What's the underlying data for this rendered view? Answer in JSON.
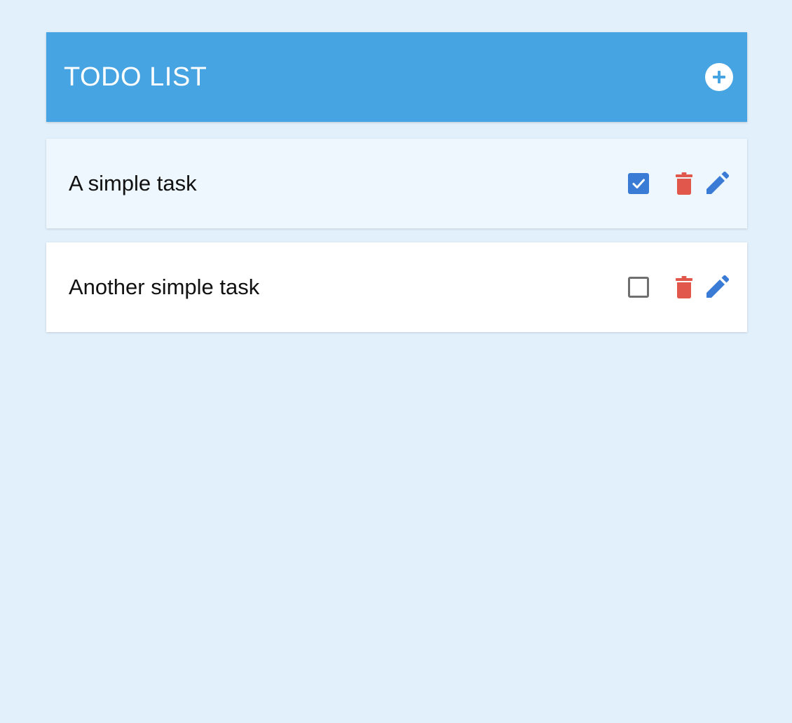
{
  "header": {
    "title": "TODO LIST",
    "add_icon": "plus-circle-icon"
  },
  "tasks": [
    {
      "text": "A simple task",
      "completed": true
    },
    {
      "text": "Another simple task",
      "completed": false
    }
  ],
  "icons": {
    "checkbox_checked": "check-icon",
    "delete": "trash-icon",
    "edit": "pencil-icon"
  },
  "colors": {
    "background": "#e2f0fc",
    "header": "#47a4e2",
    "completed_row": "#eef6fe",
    "checkbox_checked": "#3a7bd5",
    "delete": "#e2574c",
    "edit": "#3a7bd5"
  }
}
